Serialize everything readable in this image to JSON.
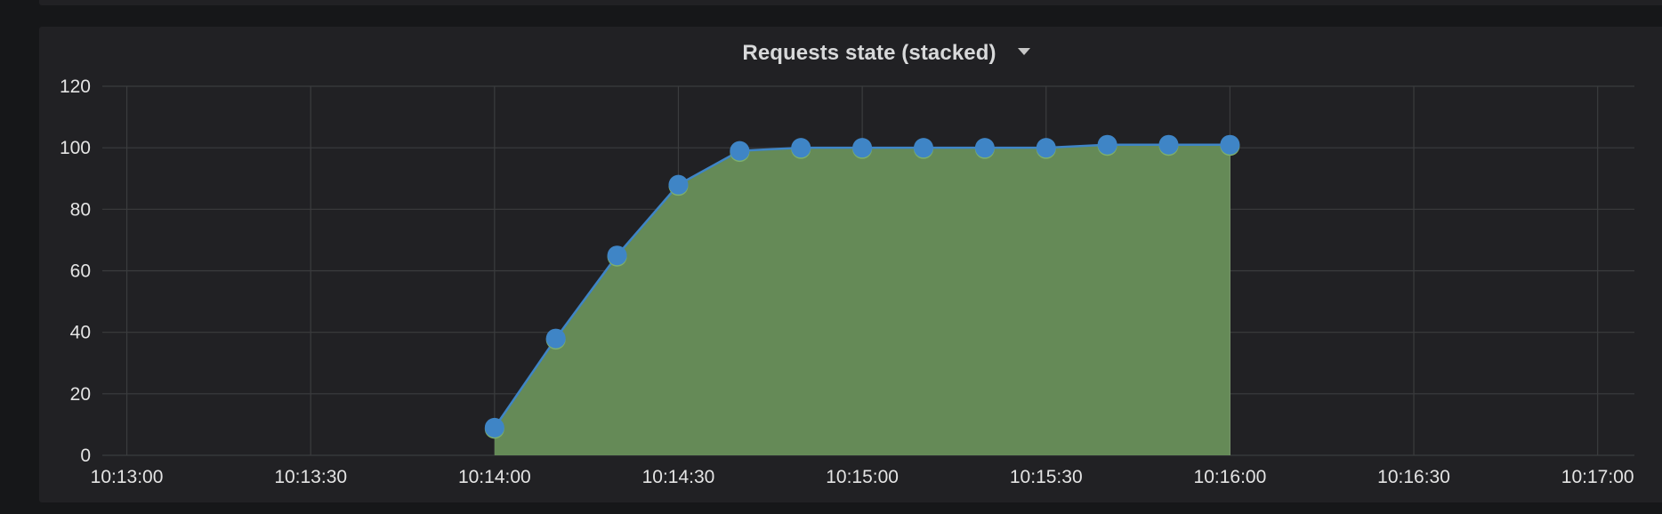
{
  "panel": {
    "title": "Requests state (stacked)"
  },
  "colors": {
    "background": "#161719",
    "panel": "#212124",
    "grid": "#3b3c3e",
    "line": "#3f85c6",
    "fill": "#658a57",
    "text": "#e4e4e4"
  },
  "chart_data": {
    "type": "area",
    "title": "Requests state (stacked)",
    "stacked": true,
    "x_ticks": [
      "10:13:00",
      "10:13:30",
      "10:14:00",
      "10:14:30",
      "10:15:00",
      "10:15:30",
      "10:16:00",
      "10:16:30",
      "10:17:00"
    ],
    "y_ticks": [
      0,
      20,
      40,
      60,
      80,
      100,
      120
    ],
    "xlim": [
      "10:12:56",
      "10:17:06"
    ],
    "ylim": [
      0,
      120
    ],
    "grid": true,
    "series": [
      {
        "x": [
          "10:14:00",
          "10:14:10",
          "10:14:20",
          "10:14:30",
          "10:14:40",
          "10:14:50",
          "10:15:00",
          "10:15:10",
          "10:15:20",
          "10:15:30",
          "10:15:40",
          "10:15:50",
          "10:16:00"
        ],
        "values": [
          9,
          38,
          65,
          88,
          99,
          100,
          100,
          100,
          100,
          100,
          101,
          101,
          101
        ]
      }
    ]
  }
}
